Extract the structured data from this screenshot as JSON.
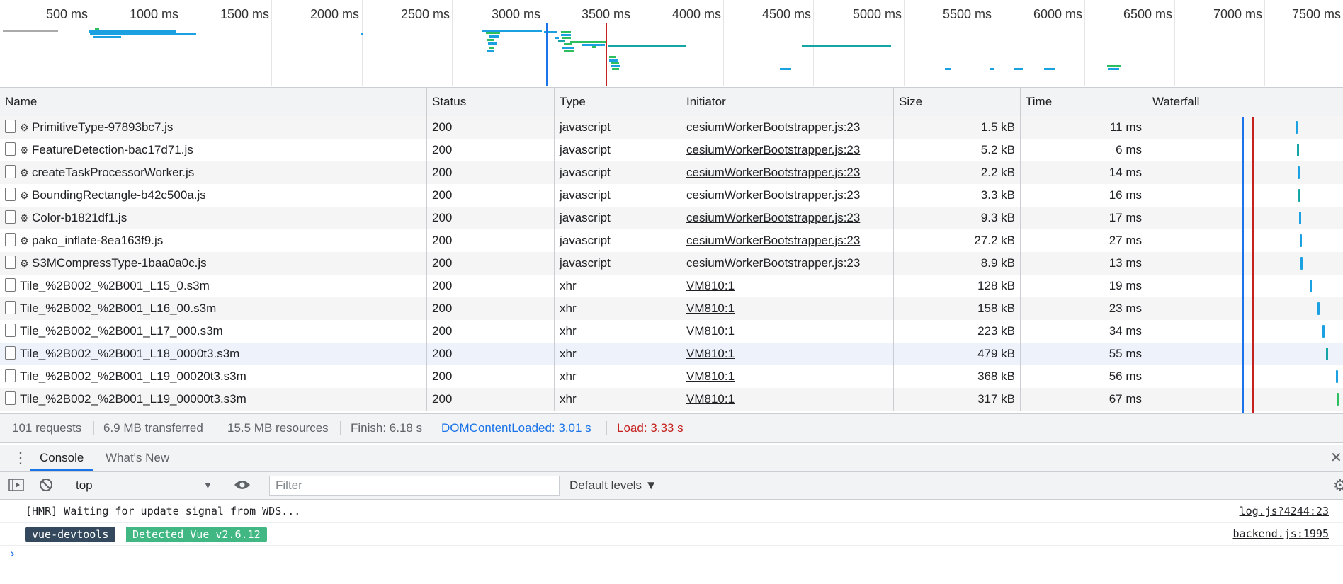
{
  "overview": {
    "tick_labels": [
      "500 ms",
      "1000 ms",
      "1500 ms",
      "2000 ms",
      "2500 ms",
      "3000 ms",
      "3500 ms",
      "4000 ms",
      "4500 ms",
      "5000 ms",
      "5500 ms",
      "6000 ms",
      "6500 ms",
      "7000 ms",
      "7500 ms"
    ]
  },
  "columns": [
    "Name",
    "Status",
    "Type",
    "Initiator",
    "Size",
    "Time",
    "Waterfall"
  ],
  "requests": [
    {
      "name": "PrimitiveType-97893bc7.js",
      "worker": true,
      "status": "200",
      "type": "javascript",
      "initiator": "cesiumWorkerBootstrapper.js:23",
      "size": "1.5 kB",
      "time": "11 ms"
    },
    {
      "name": "FeatureDetection-bac17d71.js",
      "worker": true,
      "status": "200",
      "type": "javascript",
      "initiator": "cesiumWorkerBootstrapper.js:23",
      "size": "5.2 kB",
      "time": "6 ms"
    },
    {
      "name": "createTaskProcessorWorker.js",
      "worker": true,
      "status": "200",
      "type": "javascript",
      "initiator": "cesiumWorkerBootstrapper.js:23",
      "size": "2.2 kB",
      "time": "14 ms"
    },
    {
      "name": "BoundingRectangle-b42c500a.js",
      "worker": true,
      "status": "200",
      "type": "javascript",
      "initiator": "cesiumWorkerBootstrapper.js:23",
      "size": "3.3 kB",
      "time": "16 ms"
    },
    {
      "name": "Color-b1821df1.js",
      "worker": true,
      "status": "200",
      "type": "javascript",
      "initiator": "cesiumWorkerBootstrapper.js:23",
      "size": "9.3 kB",
      "time": "17 ms"
    },
    {
      "name": "pako_inflate-8ea163f9.js",
      "worker": true,
      "status": "200",
      "type": "javascript",
      "initiator": "cesiumWorkerBootstrapper.js:23",
      "size": "27.2 kB",
      "time": "27 ms"
    },
    {
      "name": "S3MCompressType-1baa0a0c.js",
      "worker": true,
      "status": "200",
      "type": "javascript",
      "initiator": "cesiumWorkerBootstrapper.js:23",
      "size": "8.9 kB",
      "time": "13 ms"
    },
    {
      "name": "Tile_%2B002_%2B001_L15_0.s3m",
      "worker": false,
      "status": "200",
      "type": "xhr",
      "initiator": "VM810:1",
      "size": "128 kB",
      "time": "19 ms"
    },
    {
      "name": "Tile_%2B002_%2B001_L16_00.s3m",
      "worker": false,
      "status": "200",
      "type": "xhr",
      "initiator": "VM810:1",
      "size": "158 kB",
      "time": "23 ms"
    },
    {
      "name": "Tile_%2B002_%2B001_L17_000.s3m",
      "worker": false,
      "status": "200",
      "type": "xhr",
      "initiator": "VM810:1",
      "size": "223 kB",
      "time": "34 ms"
    },
    {
      "name": "Tile_%2B002_%2B001_L18_0000t3.s3m",
      "worker": false,
      "status": "200",
      "type": "xhr",
      "initiator": "VM810:1",
      "size": "479 kB",
      "time": "55 ms"
    },
    {
      "name": "Tile_%2B002_%2B001_L19_00020t3.s3m",
      "worker": false,
      "status": "200",
      "type": "xhr",
      "initiator": "VM810:1",
      "size": "368 kB",
      "time": "56 ms"
    },
    {
      "name": "Tile_%2B002_%2B001_L19_00000t3.s3m",
      "worker": false,
      "status": "200",
      "type": "xhr",
      "initiator": "VM810:1",
      "size": "317 kB",
      "time": "67 ms"
    }
  ],
  "summary": {
    "requests": "101 requests",
    "transferred": "6.9 MB transferred",
    "resources": "15.5 MB resources",
    "finish": "Finish: 6.18 s",
    "dcl": "DOMContentLoaded: 3.01 s",
    "load": "Load: 3.33 s"
  },
  "drawer": {
    "tabs": [
      "Console",
      "What's New"
    ]
  },
  "console_toolbar": {
    "context": "top",
    "filter_placeholder": "Filter",
    "levels": "Default levels ▼"
  },
  "console_messages": {
    "hmr_text": "[HMR] Waiting for update signal from WDS...",
    "hmr_source": "log.js?4244:23",
    "badge_left": "vue-devtools",
    "badge_right": "Detected Vue v2.6.12",
    "vue_source": "backend.js:1995"
  },
  "colors": {
    "dcl": "#1a73e8",
    "load": "#c5221f",
    "bar_blue": "#1ba1e2",
    "bar_green": "#2dbe60",
    "bar_teal": "#16a5a5"
  }
}
